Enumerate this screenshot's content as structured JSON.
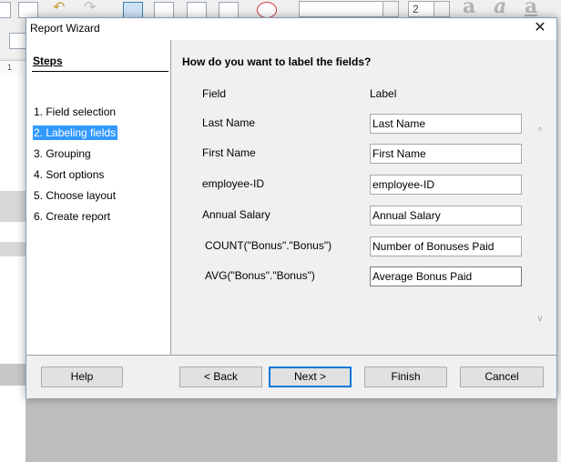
{
  "background": {
    "toolbar_font_size": "2",
    "ruler_mark": "1",
    "glyphs": [
      "a",
      "a",
      "a"
    ]
  },
  "dialog": {
    "title": "Report Wizard",
    "close_glyph": "✕",
    "steps_title": "Steps",
    "steps": [
      {
        "label": "1. Field selection",
        "active": false
      },
      {
        "label": "2. Labeling fields",
        "active": true
      },
      {
        "label": "3. Grouping",
        "active": false
      },
      {
        "label": "4. Sort options",
        "active": false
      },
      {
        "label": "5. Choose layout",
        "active": false
      },
      {
        "label": "6. Create report",
        "active": false
      }
    ],
    "question": "How do you want to label the fields?",
    "column_headers": {
      "field": "Field",
      "label": "Label"
    },
    "rows": [
      {
        "field": "Last Name",
        "label": "Last Name"
      },
      {
        "field": "First Name",
        "label": "First Name"
      },
      {
        "field": "employee-ID",
        "label": "employee-ID"
      },
      {
        "field": "Annual Salary",
        "label": "Annual Salary"
      },
      {
        "field": "COUNT(\"Bonus\".\"Bonus\")",
        "label": "Number of Bonuses Paid"
      },
      {
        "field": "AVG(\"Bonus\".\"Bonus\")",
        "label": "Average Bonus Paid"
      }
    ],
    "buttons": {
      "help": "Help",
      "back": "< Back",
      "next": "Next >",
      "finish": "Finish",
      "cancel": "Cancel"
    }
  },
  "colors": {
    "active_step_bg": "#3399ff",
    "default_button_border": "#0078d7"
  }
}
